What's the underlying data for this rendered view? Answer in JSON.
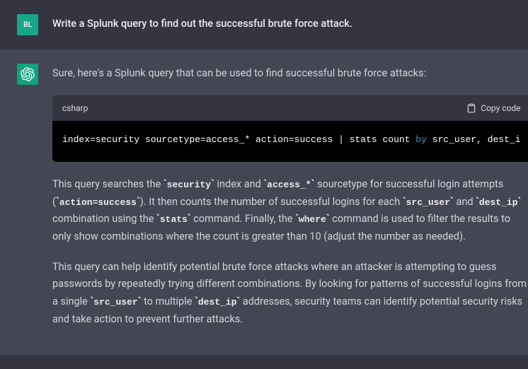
{
  "user": {
    "avatar_initials": "BL",
    "message": "Write a Splunk query to find out the successful brute force attack."
  },
  "assistant": {
    "intro": "Sure, here's a Splunk query that can be used to find successful brute force attacks:",
    "code": {
      "language": "csharp",
      "copy_label": "Copy code",
      "content_pre": "index=security sourcetype=access_* action=success | stats count ",
      "keyword": "by",
      "content_post": " src_user, dest_i"
    },
    "para1": {
      "t1": "This query searches the ",
      "c1": "security",
      "t2": " index and ",
      "c2": "access_*",
      "t3": " sourcetype for successful login attempts (",
      "c3": "action=success",
      "t4": "). It then counts the number of successful logins for each ",
      "c4": "src_user",
      "t5": " and ",
      "c5": "dest_ip",
      "t6": " combination using the ",
      "c6": "stats",
      "t7": " command. Finally, the ",
      "c7": "where",
      "t8": " command is used to filter the results to only show combinations where the count is greater than 10 (adjust the number as needed)."
    },
    "para2": {
      "t1": "This query can help identify potential brute force attacks where an attacker is attempting to guess passwords by repeatedly trying different combinations. By looking for patterns of successful logins from a single ",
      "c1": "src_user",
      "t2": " to multiple ",
      "c2": "dest_ip",
      "t3": " addresses, security teams can identify potential security risks and take action to prevent further attacks."
    }
  }
}
